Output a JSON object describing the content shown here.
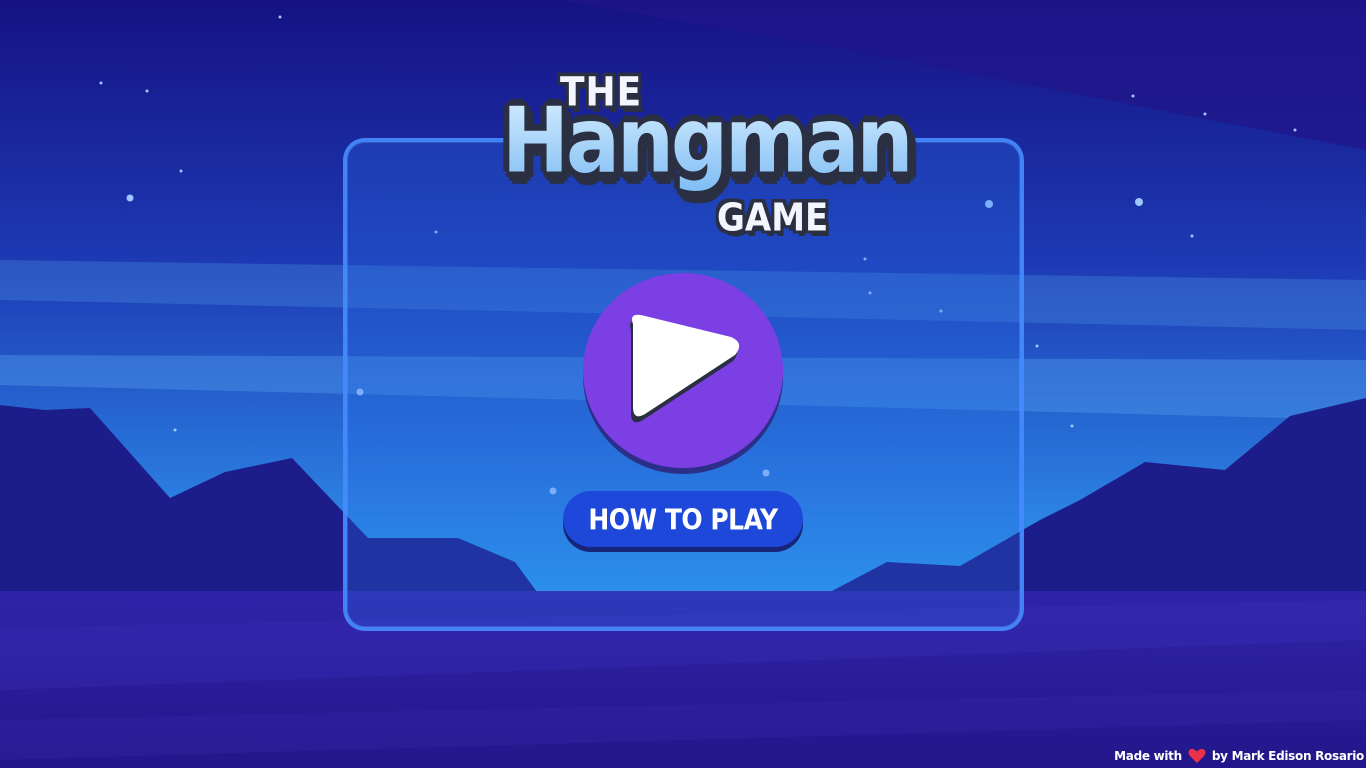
{
  "game": {
    "logo": {
      "the": "THE",
      "title": "Hangman",
      "game": "GAME"
    },
    "play_button": {
      "icon": "play-icon"
    },
    "how_to_play_label": "HOW TO PLAY"
  },
  "footer": {
    "made_with": "Made with",
    "heart_icon": "heart-icon",
    "by_author": "by Mark Edison Rosario"
  },
  "colors": {
    "sky_top": "#15138a",
    "sky_bottom": "#2d8fe8",
    "mountains": "#1d1e8c",
    "ground": "#2a1d9c",
    "panel_border": "#468cff",
    "play_button": "#7b3fe4",
    "how_button": "#1d48d9",
    "logo_outline": "#2a2f42",
    "heart": "#e8334a"
  }
}
